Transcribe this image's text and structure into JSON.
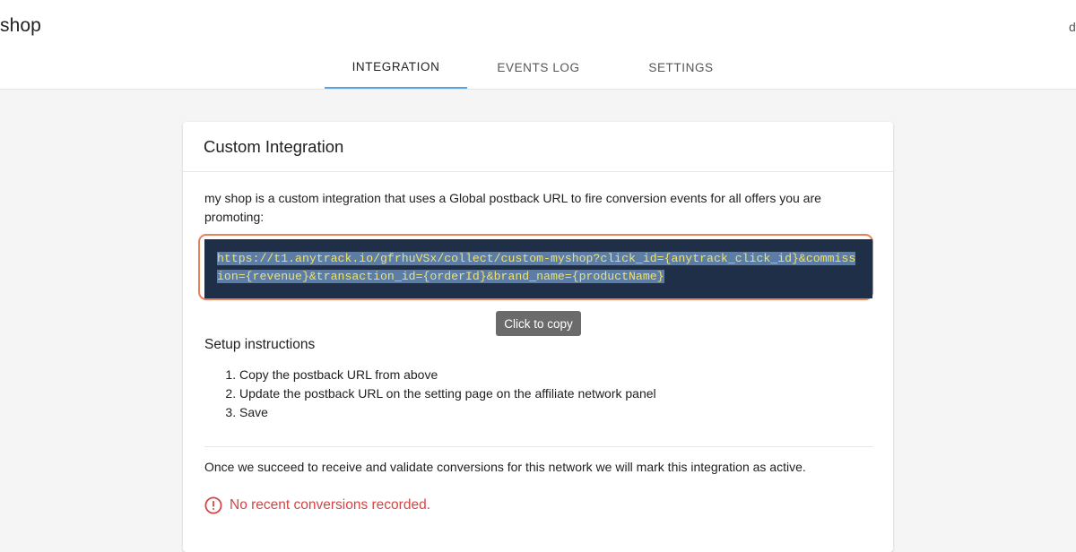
{
  "header": {
    "app_title": "shop",
    "user_initial": "d",
    "tabs": [
      {
        "label": "INTEGRATION",
        "active": true
      },
      {
        "label": "EVENTS LOG",
        "active": false
      },
      {
        "label": "SETTINGS",
        "active": false
      }
    ]
  },
  "card": {
    "title": "Custom Integration",
    "description": "my shop is a custom integration that uses a Global postback URL to fire conversion events for all offers you are promoting:",
    "postback_url": "https://t1.anytrack.io/gfrhuVSx/collect/custom-myshop?click_id={anytrack_click_id}&commission={revenue}&transaction_id={orderId}&brand_name={productName}",
    "copy_tooltip": "Click to copy",
    "setup_heading": "Setup instructions",
    "steps": [
      "Copy the postback URL from above",
      "Update the postback URL on the setting page on the affiliate network panel",
      "Save"
    ],
    "active_note": "Once we succeed to receive and validate conversions for this network we will mark this integration as active.",
    "status_message": "No recent conversions recorded.",
    "status_icon": "alert-circle-icon"
  },
  "colors": {
    "accent_tab_underline": "#5aa3e0",
    "url_background": "#1e2f47",
    "url_text": "#f0e06a",
    "url_selection": "#5c7ea6",
    "highlight_outline": "#e8825c",
    "error": "#d64545"
  }
}
